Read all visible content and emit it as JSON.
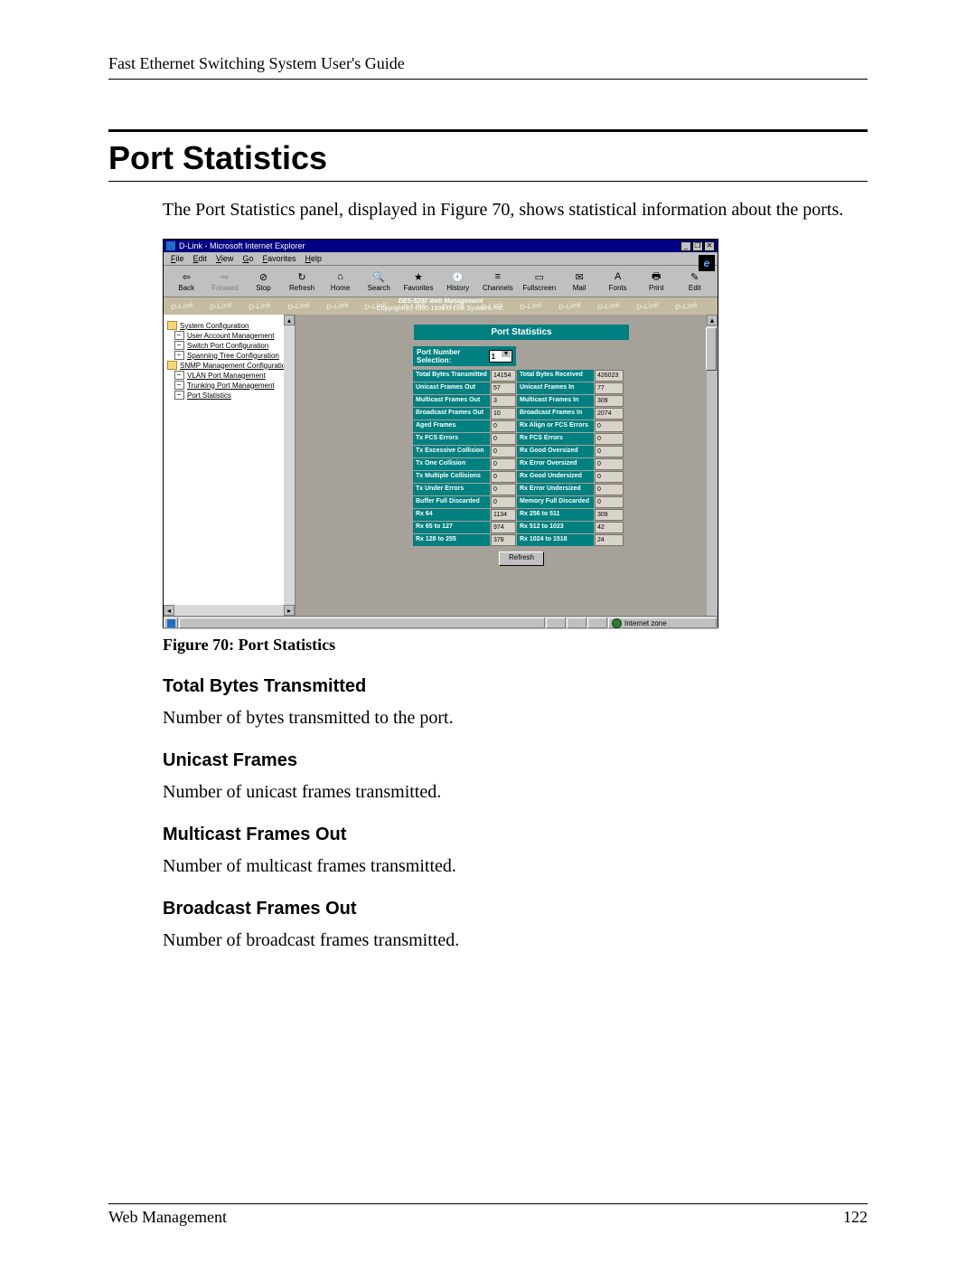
{
  "doc": {
    "running_head": "Fast Ethernet Switching System User's Guide",
    "section_title": "Port Statistics",
    "intro": "The Port Statistics panel, displayed in Figure 70, shows statistical information about the ports.",
    "fig_caption": "Figure 70: Port Statistics",
    "terms": [
      {
        "h": "Total Bytes Transmitted",
        "p": "Number of bytes transmitted to the port."
      },
      {
        "h": "Unicast Frames",
        "p": "Number of unicast frames transmitted."
      },
      {
        "h": "Multicast Frames Out",
        "p": "Number of multicast frames transmitted."
      },
      {
        "h": "Broadcast Frames Out",
        "p": "Number of broadcast frames transmitted."
      }
    ],
    "footer_left": "Web Management",
    "footer_right": "122"
  },
  "shot": {
    "title": "D-Link - Microsoft Internet Explorer",
    "menus": [
      "File",
      "Edit",
      "View",
      "Go",
      "Favorites",
      "Help"
    ],
    "tools": [
      {
        "icon": "⇦",
        "label": "Back",
        "en": true
      },
      {
        "icon": "⇨",
        "label": "Forward",
        "en": false
      },
      {
        "icon": "⊘",
        "label": "Stop",
        "en": true
      },
      {
        "icon": "↻",
        "label": "Refresh",
        "en": true
      },
      {
        "icon": "⌂",
        "label": "Home",
        "en": true
      },
      {
        "icon": "🔍",
        "label": "Search",
        "en": true
      },
      {
        "icon": "★",
        "label": "Favorites",
        "en": true
      },
      {
        "icon": "🕘",
        "label": "History",
        "en": true
      },
      {
        "icon": "≡",
        "label": "Channels",
        "en": true
      },
      {
        "icon": "▭",
        "label": "Fullscreen",
        "en": true
      },
      {
        "icon": "✉",
        "label": "Mail",
        "en": true
      },
      {
        "icon": "A",
        "label": "Fonts",
        "en": true
      },
      {
        "icon": "🖶",
        "label": "Print",
        "en": true
      },
      {
        "icon": "✎",
        "label": "Edit",
        "en": true
      }
    ],
    "banner": {
      "brand": "D-Link",
      "line1": "DES-5200 Web Management",
      "line2": "Copyright (c) 1995-1999 D-Link Systems, Inc."
    },
    "tree": [
      {
        "icon": "f",
        "label": "System Configuration",
        "link": true
      },
      {
        "icon": "d",
        "label": "User Account Management",
        "link": true,
        "sub": true
      },
      {
        "icon": "d",
        "label": "Switch Port Configuration",
        "link": true,
        "sub": true
      },
      {
        "icon": "d",
        "label": "Spanning Tree Configuration",
        "link": true,
        "sub": true
      },
      {
        "icon": "f",
        "label": "SNMP Management Configuration",
        "link": true
      },
      {
        "icon": "d",
        "label": "VLAN Port Management",
        "link": true,
        "sub": true
      },
      {
        "icon": "d",
        "label": "Trunking Port Management",
        "link": true,
        "sub": true
      },
      {
        "icon": "d",
        "label": "Port Statistics",
        "link": true,
        "sub": true
      }
    ],
    "panel": {
      "title": "Port Statistics",
      "port_label": "Port Number Selection:",
      "port_value": "1",
      "refresh": "Refresh",
      "rows": [
        {
          "l1": "Total Bytes Transmitted",
          "v1": "14154",
          "l2": "Total Bytes Received",
          "v2": "426023"
        },
        {
          "l1": "Unicast Frames Out",
          "v1": "57",
          "l2": "Unicast Frames In",
          "v2": "77"
        },
        {
          "l1": "Multicast Frames Out",
          "v1": "3",
          "l2": "Multicast Frames In",
          "v2": "309"
        },
        {
          "l1": "Broadcast Frames Out",
          "v1": "10",
          "l2": "Broadcast Frames In",
          "v2": "2074"
        },
        {
          "l1": "Aged Frames",
          "v1": "0",
          "l2": "Rx Align or FCS Errors",
          "v2": "0"
        },
        {
          "l1": "Tx FCS Errors",
          "v1": "0",
          "l2": "Rx FCS Errors",
          "v2": "0"
        },
        {
          "l1": "Tx Excessive Collision",
          "v1": "0",
          "l2": "Rx Good Oversized",
          "v2": "0"
        },
        {
          "l1": "Tx One Collision",
          "v1": "0",
          "l2": "Rx Error Oversized",
          "v2": "0"
        },
        {
          "l1": "Tx Multiple Collisions",
          "v1": "0",
          "l2": "Rx Good Undersized",
          "v2": "0"
        },
        {
          "l1": "Tx Under Errors",
          "v1": "0",
          "l2": "Rx Error Undersized",
          "v2": "0"
        },
        {
          "l1": "Buffer Full Discarded",
          "v1": "0",
          "l2": "Memory Full Discarded",
          "v2": "0"
        },
        {
          "l1": "Rx 64",
          "v1": "1134",
          "l2": "Rx 256 to 511",
          "v2": "309"
        },
        {
          "l1": "Rx 65 to 127",
          "v1": "974",
          "l2": "Rx 512 to 1023",
          "v2": "42"
        },
        {
          "l1": "Rx 128 to 255",
          "v1": "378",
          "l2": "Rx 1024 to 1518",
          "v2": "24"
        }
      ]
    },
    "status": {
      "zone": "Internet zone"
    }
  }
}
